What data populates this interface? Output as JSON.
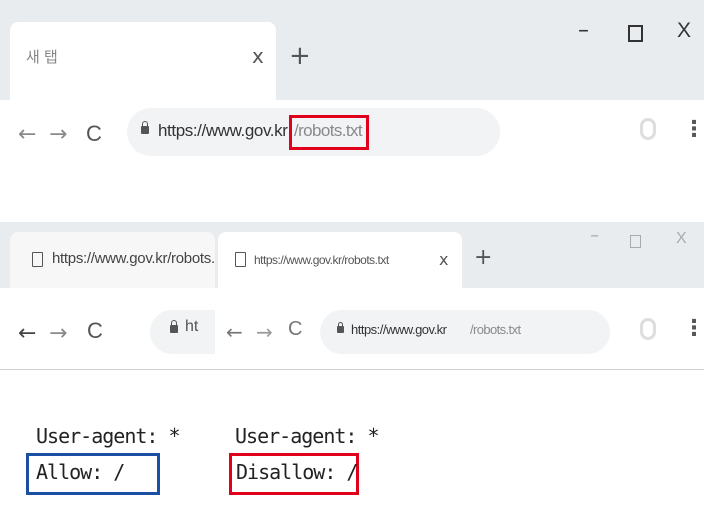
{
  "top_browser": {
    "tab": {
      "title": "새 탭",
      "close": "x"
    },
    "new_tab": "+",
    "window": {
      "minimize": "–",
      "close": "X"
    },
    "nav": {
      "back": "←",
      "forward": "→",
      "reload": "C"
    },
    "address": {
      "host": "https://www.gov.kr",
      "path": "/robots.txt"
    },
    "menu": "⋮",
    "highlight_color": "#e0001b"
  },
  "bottom_browser": {
    "tabs": [
      {
        "title": "https://www.gov.kr/robots.txt"
      },
      {
        "title": "https://www.gov.kr/robots.txt",
        "close": "x"
      }
    ],
    "new_tab": "+",
    "window": {
      "minimize": "–",
      "close": "X"
    },
    "nav": {
      "back": "←",
      "forward": "→",
      "reload": "C"
    },
    "address_truncated": "ht",
    "inset_nav": {
      "back": "←",
      "forward": "→",
      "reload": "C"
    },
    "inset_address": {
      "host": "https://www.gov.kr",
      "path": "/robots.txt"
    },
    "menu": "⋮"
  },
  "robots_content": {
    "left": {
      "user_agent": "User-agent: *",
      "rule": "Allow: /",
      "box_color": "#1b4fa3"
    },
    "right": {
      "user_agent": "User-agent: *",
      "rule": "Disallow: /",
      "box_color": "#e0001b"
    }
  }
}
